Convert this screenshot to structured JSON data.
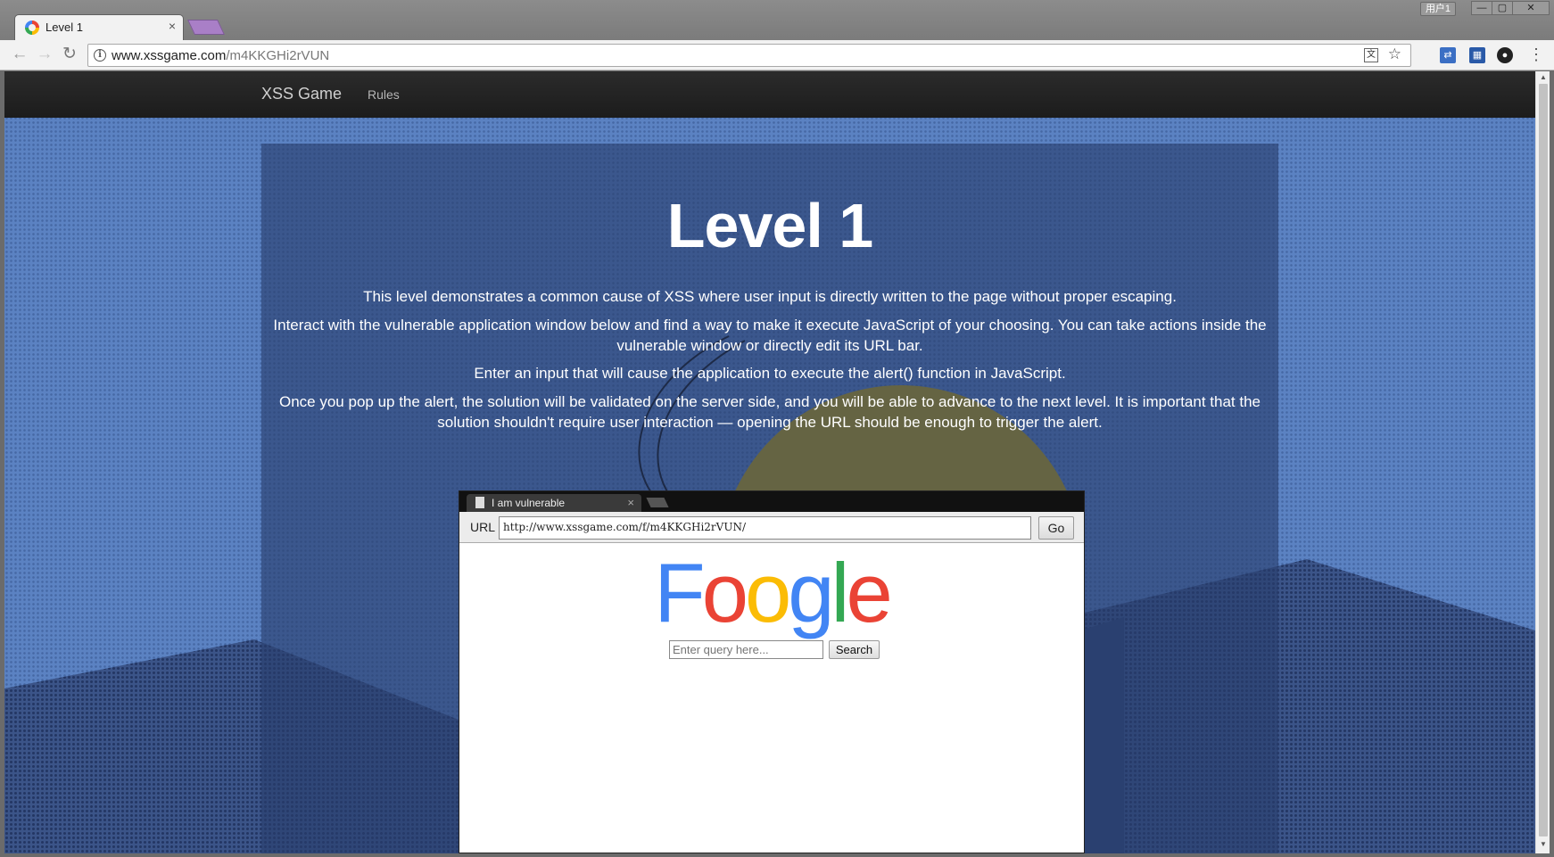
{
  "browser": {
    "tab_title": "Level 1",
    "tab_close": "×",
    "user_label": "用户1",
    "window_controls": [
      "—",
      "▢",
      "✕"
    ],
    "url_host": "www.xssgame.com",
    "url_path": "/m4KKGHi2rVUN",
    "nav": {
      "back": "←",
      "forward": "→",
      "reload": "↻"
    },
    "icons": [
      "info-icon",
      "translate-icon",
      "star-icon",
      "extension-icon",
      "menu-icon"
    ]
  },
  "site": {
    "brand": "XSS Game",
    "nav_rules": "Rules"
  },
  "level": {
    "title": "Level 1",
    "paragraphs": [
      "This level demonstrates a common cause of XSS where user input is directly written to the page without proper escaping.",
      "Interact with the vulnerable application window below and find a way to make it execute JavaScript of your choosing. You can take actions inside the vulnerable window or directly edit its URL bar.",
      "Enter an input that will cause the application to execute the alert() function in JavaScript.",
      "Once you pop up the alert, the solution will be validated on the server side, and you will be able to advance to the next level. It is important that the solution shouldn't require user interaction — opening the URL should be enough to trigger the alert."
    ]
  },
  "vulnerable_app": {
    "tab_title": "I am vulnerable",
    "tab_close": "×",
    "url_label": "URL",
    "url_value": "http://www.xssgame.com/f/m4KKGHi2rVUN/",
    "go_label": "Go",
    "logo_letters": [
      "F",
      "o",
      "o",
      "g",
      "l",
      "e"
    ],
    "search_placeholder": "Enter query here...",
    "search_button": "Search"
  },
  "colors": {
    "logo": [
      "#4285f4",
      "#ea4335",
      "#fbbc05",
      "#4285f4",
      "#34a853",
      "#ea4335"
    ],
    "sun": "#c9a300",
    "page_background": "#5b82c2"
  }
}
